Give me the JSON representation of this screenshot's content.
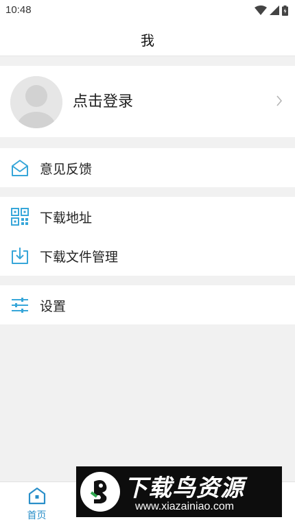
{
  "status_bar": {
    "time": "10:48"
  },
  "header": {
    "title": "我"
  },
  "profile": {
    "login_label": "点击登录"
  },
  "menu": {
    "feedback": {
      "label": "意见反馈",
      "icon": "mail-open-icon"
    },
    "download_address": {
      "label": "下载地址",
      "icon": "qr-code-icon"
    },
    "download_manager": {
      "label": "下载文件管理",
      "icon": "download-tray-icon"
    },
    "settings": {
      "label": "设置",
      "icon": "sliders-icon"
    }
  },
  "bottom_nav": {
    "items": [
      {
        "label": "首页",
        "icon": "home-icon",
        "active": true
      }
    ]
  },
  "watermark": {
    "title": "下载鸟资源",
    "url": "www.xiazainiao.com"
  },
  "colors": {
    "accent": "#2a8fc9",
    "icon_blue": "#37a6d9",
    "background": "#f1f1f1"
  }
}
